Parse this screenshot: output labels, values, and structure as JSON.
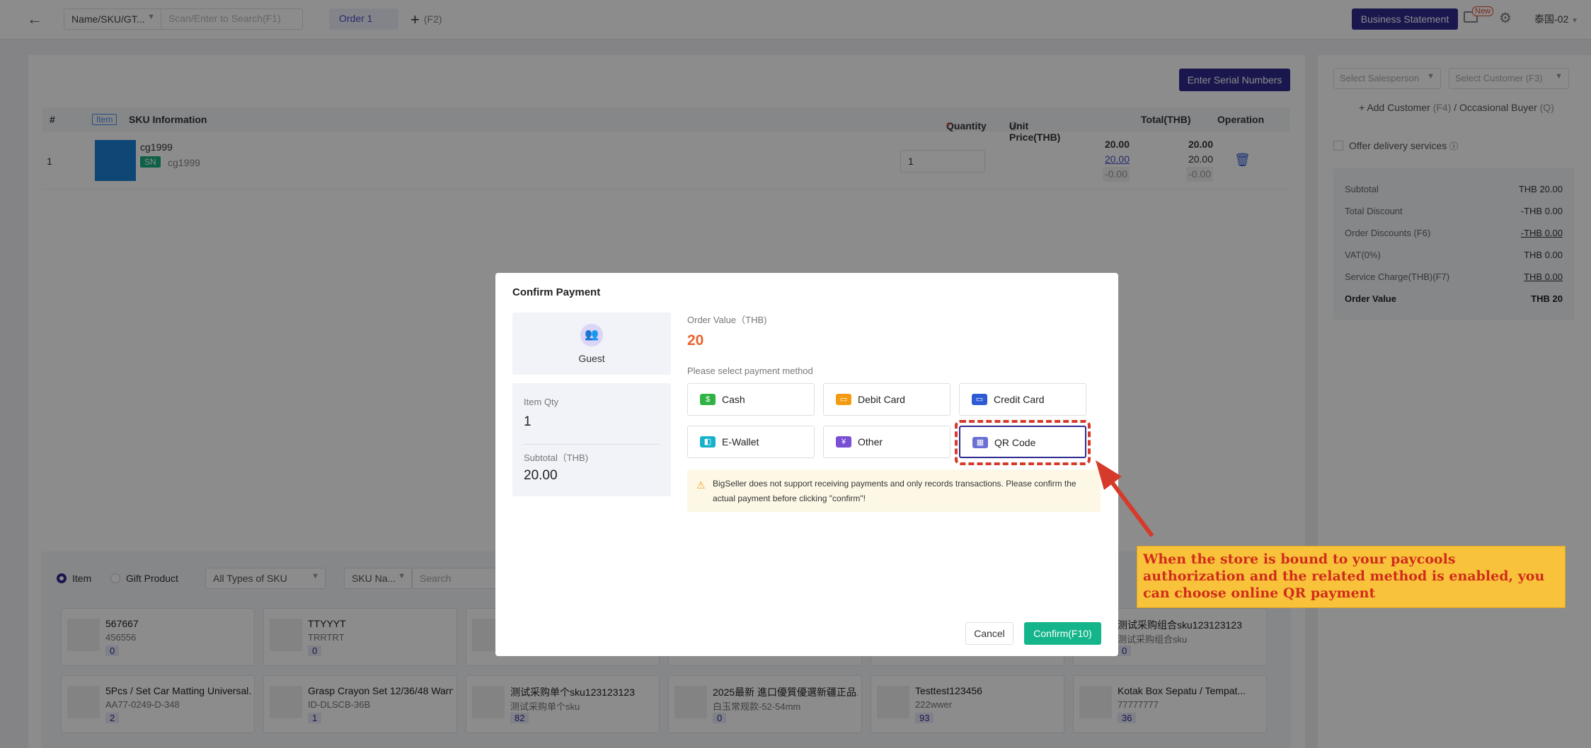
{
  "topbar": {
    "search_type": "Name/SKU/GT...",
    "search_placeholder": "Scan/Enter to Search(F1)",
    "order_tab": "Order 1",
    "add_order_shortcut": "(F2)",
    "business_statement": "Business Statement",
    "new_badge": "New",
    "store": "泰国-02"
  },
  "order_table": {
    "serial_button": "Enter Serial Numbers",
    "headers": {
      "index": "#",
      "item_tag": "Item",
      "sku_info": "SKU Information",
      "quantity": "Quantity",
      "required_mark": "*",
      "unit_price": "Unit Price(THB)",
      "total": "Total(THB)",
      "operation": "Operation"
    },
    "rows": [
      {
        "index": "1",
        "sku_name": "cg1999",
        "sn_tag": "SN",
        "sku_code": "cg1999",
        "quantity": "1",
        "unit_price": "20.00",
        "unit_price_link": "20.00",
        "unit_price_discount": "-0.00",
        "total": "20.00",
        "total_sub": "20.00",
        "total_discount": "-0.00"
      }
    ]
  },
  "side": {
    "salesperson_placeholder": "Select Salesperson",
    "customer_placeholder": "Select Customer (F3)",
    "add_customer": "Add Customer",
    "add_customer_key": "(F4)",
    "separator": "/",
    "occasional": "Occasional Buyer",
    "occasional_key": "(Q)",
    "offer_delivery": "Offer delivery services",
    "summary": [
      {
        "label": "Subtotal",
        "value": "THB 20.00"
      },
      {
        "label": "Total Discount",
        "value": "-THB 0.00"
      },
      {
        "label": "Order Discounts (F6)",
        "value": "-THB 0.00"
      },
      {
        "label": "VAT(0%)",
        "value": "THB 0.00"
      },
      {
        "label": "Service Charge(THB)(F7)",
        "value": "THB 0.00"
      },
      {
        "label": "Order Value",
        "value": "THB 20"
      }
    ]
  },
  "products": {
    "radio_item": "Item",
    "radio_gift": "Gift Product",
    "filter_type": "All Types of SKU",
    "filter_field": "SKU Na...",
    "search_placeholder": "Search",
    "cards_row1": [
      {
        "name": "567667",
        "code": "456556",
        "stock": "0"
      },
      {
        "name": "TTYYYT",
        "code": "TRRTRT",
        "stock": "0"
      },
      {
        "name": "",
        "code": "",
        "stock": ""
      },
      {
        "name": "",
        "code": "",
        "stock": ""
      },
      {
        "name": "",
        "code": "",
        "stock": ""
      },
      {
        "name": "测试采购组合sku123123123",
        "code": "测试采购组合sku",
        "stock": "0"
      }
    ],
    "cards_row2": [
      {
        "name": "5Pcs / Set Car Matting Universal...",
        "code": "AA77-0249-D-348",
        "stock": "2"
      },
      {
        "name": "Grasp Crayon Set 12/36/48 Warn...",
        "code": "ID-DLSCB-36B",
        "stock": "1"
      },
      {
        "name": "测试采购单个sku123123123",
        "code": "测试采购单个sku",
        "stock": "82"
      },
      {
        "name": "2025最新 進口優質優選新疆正品...",
        "code": "白玉常规款-52-54mm",
        "stock": "0"
      },
      {
        "name": "Testtest123456",
        "code": "222wwer",
        "stock": "93"
      },
      {
        "name": "Kotak Box Sepatu / Tempat...",
        "code": "77777777",
        "stock": "36"
      }
    ]
  },
  "modal": {
    "title": "Confirm Payment",
    "guest": "Guest",
    "item_qty_label": "Item Qty",
    "item_qty": "1",
    "subtotal_label": "Subtotal（THB)",
    "subtotal": "20.00",
    "order_value_label": "Order Value（THB)",
    "order_value": "20",
    "payment_method_label": "Please select payment method",
    "methods": [
      {
        "label": "Cash",
        "icon": "cash-icon",
        "color": "#2fb344"
      },
      {
        "label": "Debit Card",
        "icon": "debit-card-icon",
        "color": "#f39c12"
      },
      {
        "label": "Credit Card",
        "icon": "credit-card-icon",
        "color": "#2e5bd4"
      },
      {
        "label": "E-Wallet",
        "icon": "wallet-icon",
        "color": "#17b2c9"
      },
      {
        "label": "Other",
        "icon": "other-icon",
        "color": "#7a4fd6"
      },
      {
        "label": "QR Code",
        "icon": "qr-code-icon",
        "color": "#6a6fd6"
      }
    ],
    "selected_method": "QR Code",
    "warning": "BigSeller does not support receiving payments and only records transactions. Please confirm the actual payment before clicking \"confirm\"!",
    "cancel": "Cancel",
    "confirm": "Confirm(F10)"
  },
  "annotation": {
    "text": "When the store is bound to your paycools authorization and the related method is enabled, you can choose online QR payment"
  },
  "colors": {
    "primary": "#2e2a8e",
    "confirm": "#14b58a",
    "order_value": "#e8642c",
    "annotation_bg": "#f8c33a",
    "annotation_text": "#d12c1c"
  }
}
